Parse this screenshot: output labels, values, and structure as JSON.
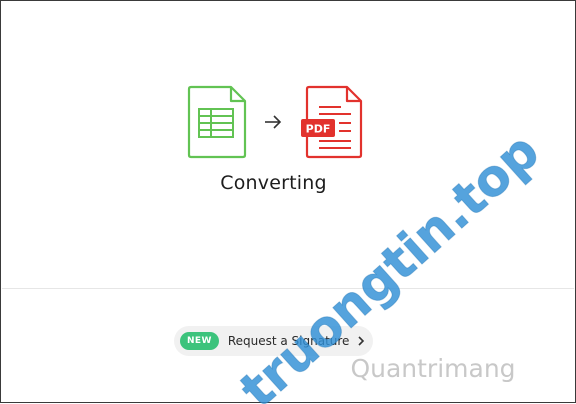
{
  "conversion": {
    "source_icon": "spreadsheet-file-icon",
    "target_icon": "pdf-file-icon",
    "target_icon_label": "PDF",
    "arrow_icon": "arrow-right-icon",
    "status_text": "Converting",
    "source_color": "#62c353",
    "target_color": "#e2322d"
  },
  "promo": {
    "badge": "NEW",
    "label": "Request a Signature",
    "chevron_icon": "chevron-right-icon",
    "badge_color": "#3cc37c"
  },
  "watermark": {
    "text": "truongtin.top",
    "subtext": "Quantrimang"
  }
}
